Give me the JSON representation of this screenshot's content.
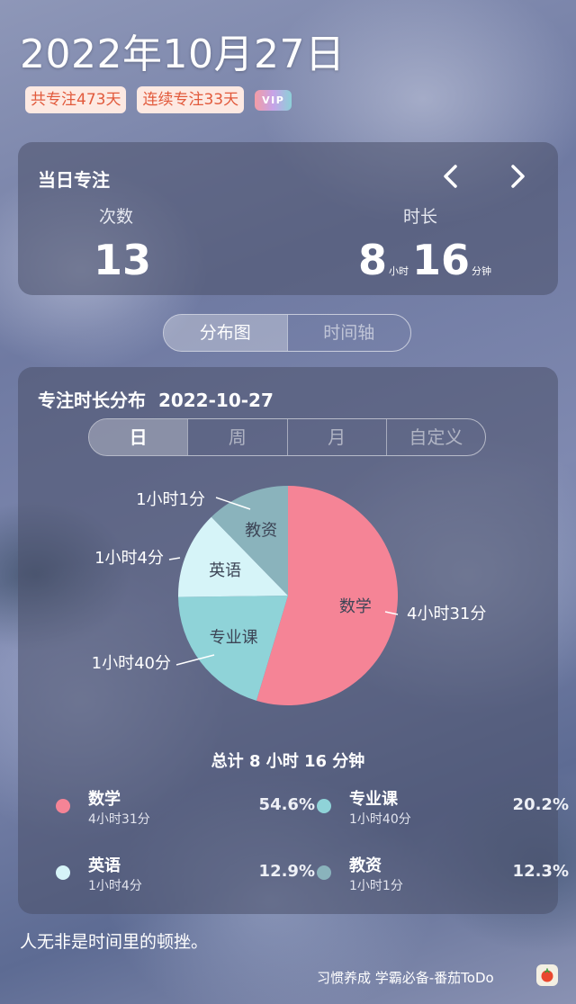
{
  "header": {
    "date": "2022年10月27日",
    "badge_total": "共专注473天",
    "badge_streak": "连续专注33天",
    "vip": "VIP"
  },
  "today": {
    "title": "当日专注",
    "count_label": "次数",
    "count_value": "13",
    "duration_label": "时长",
    "hours": "8",
    "hours_unit": "小时",
    "minutes": "16",
    "minutes_unit": "分钟"
  },
  "view_tabs": [
    "分布图",
    "时间轴"
  ],
  "distribution": {
    "title": "专注时长分布",
    "date": "2022-10-27",
    "range_tabs": [
      "日",
      "周",
      "月",
      "自定义"
    ],
    "total": "总计 8 小时 16 分钟"
  },
  "chart_data": {
    "type": "pie",
    "unit": "minutes",
    "slices": [
      {
        "name": "数学",
        "value": 271,
        "label": "4小时31分",
        "percent": "54.6%",
        "color": "#f58496"
      },
      {
        "name": "专业课",
        "value": 100,
        "label": "1小时40分",
        "percent": "20.2%",
        "color": "#8fd3d8"
      },
      {
        "name": "英语",
        "value": 64,
        "label": "1小时4分",
        "percent": "12.9%",
        "color": "#d6f4f8"
      },
      {
        "name": "教资",
        "value": 61,
        "label": "1小时1分",
        "percent": "12.3%",
        "color": "#8ab3bc"
      }
    ]
  },
  "footer": {
    "quote": "人无非是时间里的顿挫。",
    "app": "习惯养成 学霸必备-番茄ToDo"
  },
  "icons": [
    "chevron-left-icon",
    "chevron-right-icon",
    "tomato-app-icon"
  ]
}
